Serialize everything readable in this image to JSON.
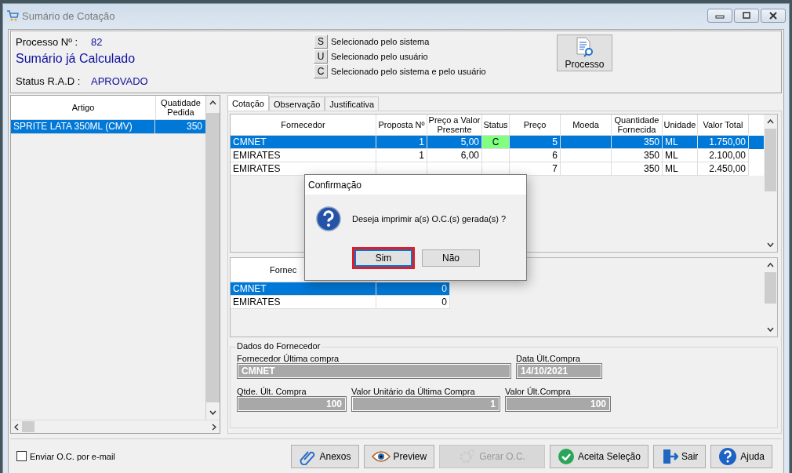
{
  "window": {
    "title": "Sumário de Cotação"
  },
  "header": {
    "process_label": "Processo Nº :",
    "process_value": "82",
    "summary": "Sumário já Calculado",
    "status_label": "Status R.A.D :",
    "status_value": "APROVADO"
  },
  "legend": [
    {
      "key": "S",
      "text": "Selecionado pelo sistema"
    },
    {
      "key": "U",
      "text": "Selecionado pelo usuário"
    },
    {
      "key": "C",
      "text": "Selecionado pelo sistema e pelo usuário"
    }
  ],
  "process_button": {
    "label": "Processo"
  },
  "items": {
    "columns": [
      "Artigo",
      "Quatidade Pedida"
    ],
    "rows": [
      {
        "cells": [
          "SPRITE LATA 350ML (CMV)",
          "350"
        ],
        "selected": true
      }
    ]
  },
  "tabs": [
    {
      "label": "Cotação",
      "selected": true
    },
    {
      "label": "Observação",
      "selected": false
    },
    {
      "label": "Justificativa",
      "selected": false
    }
  ],
  "quotes": {
    "columns": [
      "Fornecedor",
      "Proposta Nº",
      "Preço a Valor Presente",
      "Status",
      "Preço",
      "Moeda",
      "Quantidade Fornecida",
      "Unidade",
      "Valor Total"
    ],
    "rows": [
      {
        "cells": [
          "CMNET",
          "1",
          "5,00",
          "C",
          "5",
          null,
          "350",
          "ML",
          "1.750,00"
        ],
        "selected": true,
        "color": "#80ff80"
      },
      {
        "cells": [
          "EMIRATES",
          "1",
          "6,00",
          null,
          "6",
          null,
          "350",
          "ML",
          "2.100,00"
        ],
        "selected": false
      },
      {
        "cells": [
          "EMIRATES",
          null,
          null,
          null,
          "7",
          null,
          "350",
          "ML",
          "2.450,00"
        ],
        "selected": false
      }
    ]
  },
  "suppliers": {
    "columns": [
      "Fornec"
    ],
    "rows": [
      {
        "cells": [
          "CMNET",
          "0"
        ],
        "selected": true
      },
      {
        "cells": [
          "EMIRATES",
          "0"
        ],
        "selected": false
      }
    ]
  },
  "supplier_data": {
    "title": "Dados do Fornecedor",
    "fields": [
      {
        "label": "Fornecedor Última compra",
        "value": "CMNET",
        "kind": "text"
      },
      {
        "label": "Data Últ.Compra",
        "value": "14/10/2021",
        "kind": "text"
      },
      {
        "label": "Qtde. Últ. Compra",
        "value": "100",
        "kind": "number"
      },
      {
        "label": "Valor Unitário da Última Compra",
        "value": "1",
        "kind": "number"
      },
      {
        "label": "Valor Últ.Compra",
        "value": "100",
        "kind": "number"
      }
    ]
  },
  "email_checkbox": {
    "label": "Enviar O.C. por e-mail",
    "checked": false
  },
  "buttons": [
    {
      "label": "Anexos",
      "kind": "clip",
      "disabled": false
    },
    {
      "label": "Preview",
      "kind": "eye",
      "disabled": false
    },
    {
      "label": "Gerar O.C.",
      "kind": "gear",
      "disabled": true
    },
    {
      "label": "Aceita Seleção",
      "kind": "check",
      "disabled": false
    },
    {
      "label": "Sair",
      "kind": "exit",
      "disabled": false
    },
    {
      "label": "Ajuda",
      "kind": "help",
      "disabled": false
    }
  ],
  "dialog": {
    "title": "Confirmação",
    "message": "Deseja imprimir a(s) O.C.(s) gerada(s) ?",
    "buttons": [
      {
        "label": "Sim",
        "highlighted": true
      },
      {
        "label": "Não",
        "highlighted": false
      }
    ]
  }
}
